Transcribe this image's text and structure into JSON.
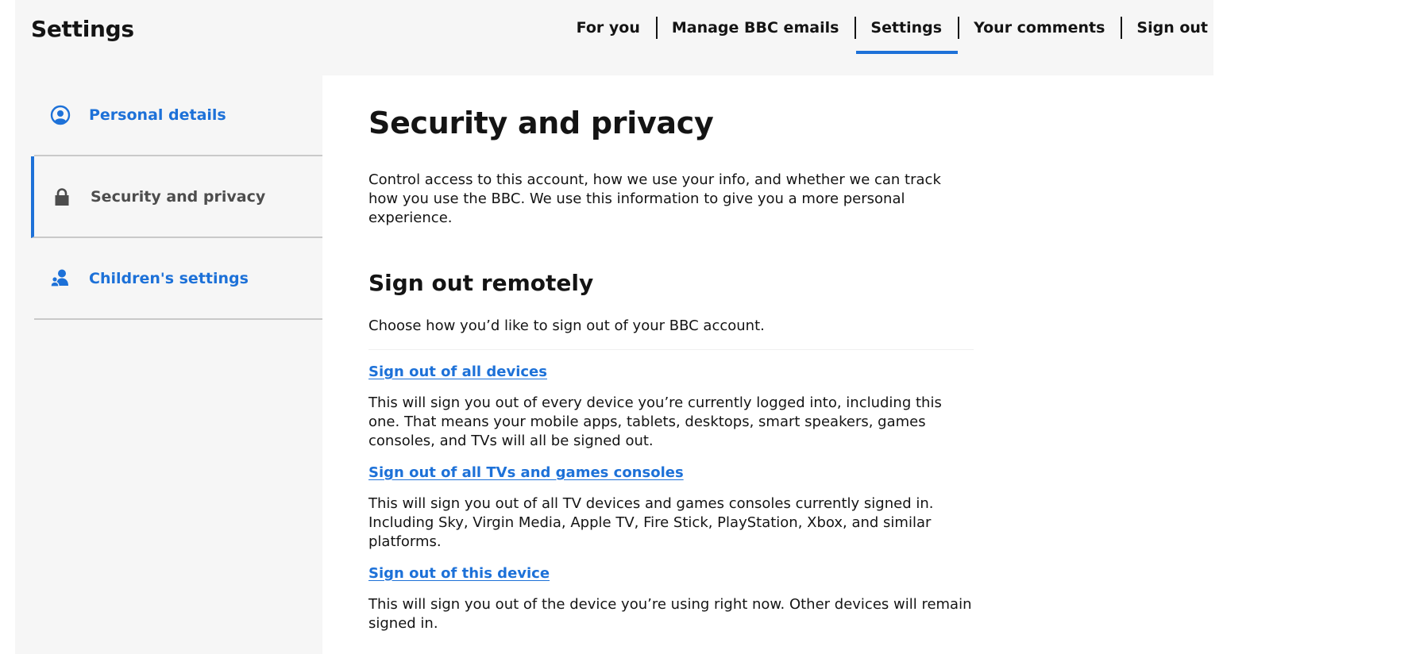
{
  "header": {
    "title": "Settings",
    "nav": [
      {
        "label": "For you"
      },
      {
        "label": "Manage BBC emails"
      },
      {
        "label": "Settings"
      },
      {
        "label": "Your comments"
      },
      {
        "label": "Sign out"
      }
    ],
    "active_nav": "Settings"
  },
  "sidebar": {
    "items": [
      {
        "label": "Personal details",
        "icon": "user-circle-icon"
      },
      {
        "label": "Security and privacy",
        "icon": "lock-icon"
      },
      {
        "label": "Children's settings",
        "icon": "parent-child-icon"
      }
    ],
    "active_item": "Security and privacy"
  },
  "main": {
    "title": "Security and privacy",
    "intro": "Control access to this account, how we use your info, and whether we can track how you use the BBC. We use this information to give you a more personal experience.",
    "section": {
      "title": "Sign out remotely",
      "intro": "Choose how you’d like to sign out of your BBC account.",
      "options": [
        {
          "link": "Sign out of all devices",
          "description": "This will sign you out of every device you’re currently logged into, including this one. That means your mobile apps, tablets, desktops, smart speakers, games consoles, and TVs will all be signed out."
        },
        {
          "link": "Sign out of all TVs and games consoles",
          "description": "This will sign you out of all TV devices and games consoles currently signed in. Including Sky, Virgin Media, Apple TV, Fire Stick, PlayStation, Xbox, and similar platforms."
        },
        {
          "link": "Sign out of this device",
          "description": "This will sign you out of the device you’re using right now. Other devices will remain signed in."
        }
      ]
    }
  },
  "colors": {
    "accent": "#1d71d8",
    "text": "#141414",
    "muted_text": "#4d4d4d",
    "panel_bg": "#f6f6f6",
    "content_bg": "#ffffff",
    "divider": "#c9c9c9"
  }
}
